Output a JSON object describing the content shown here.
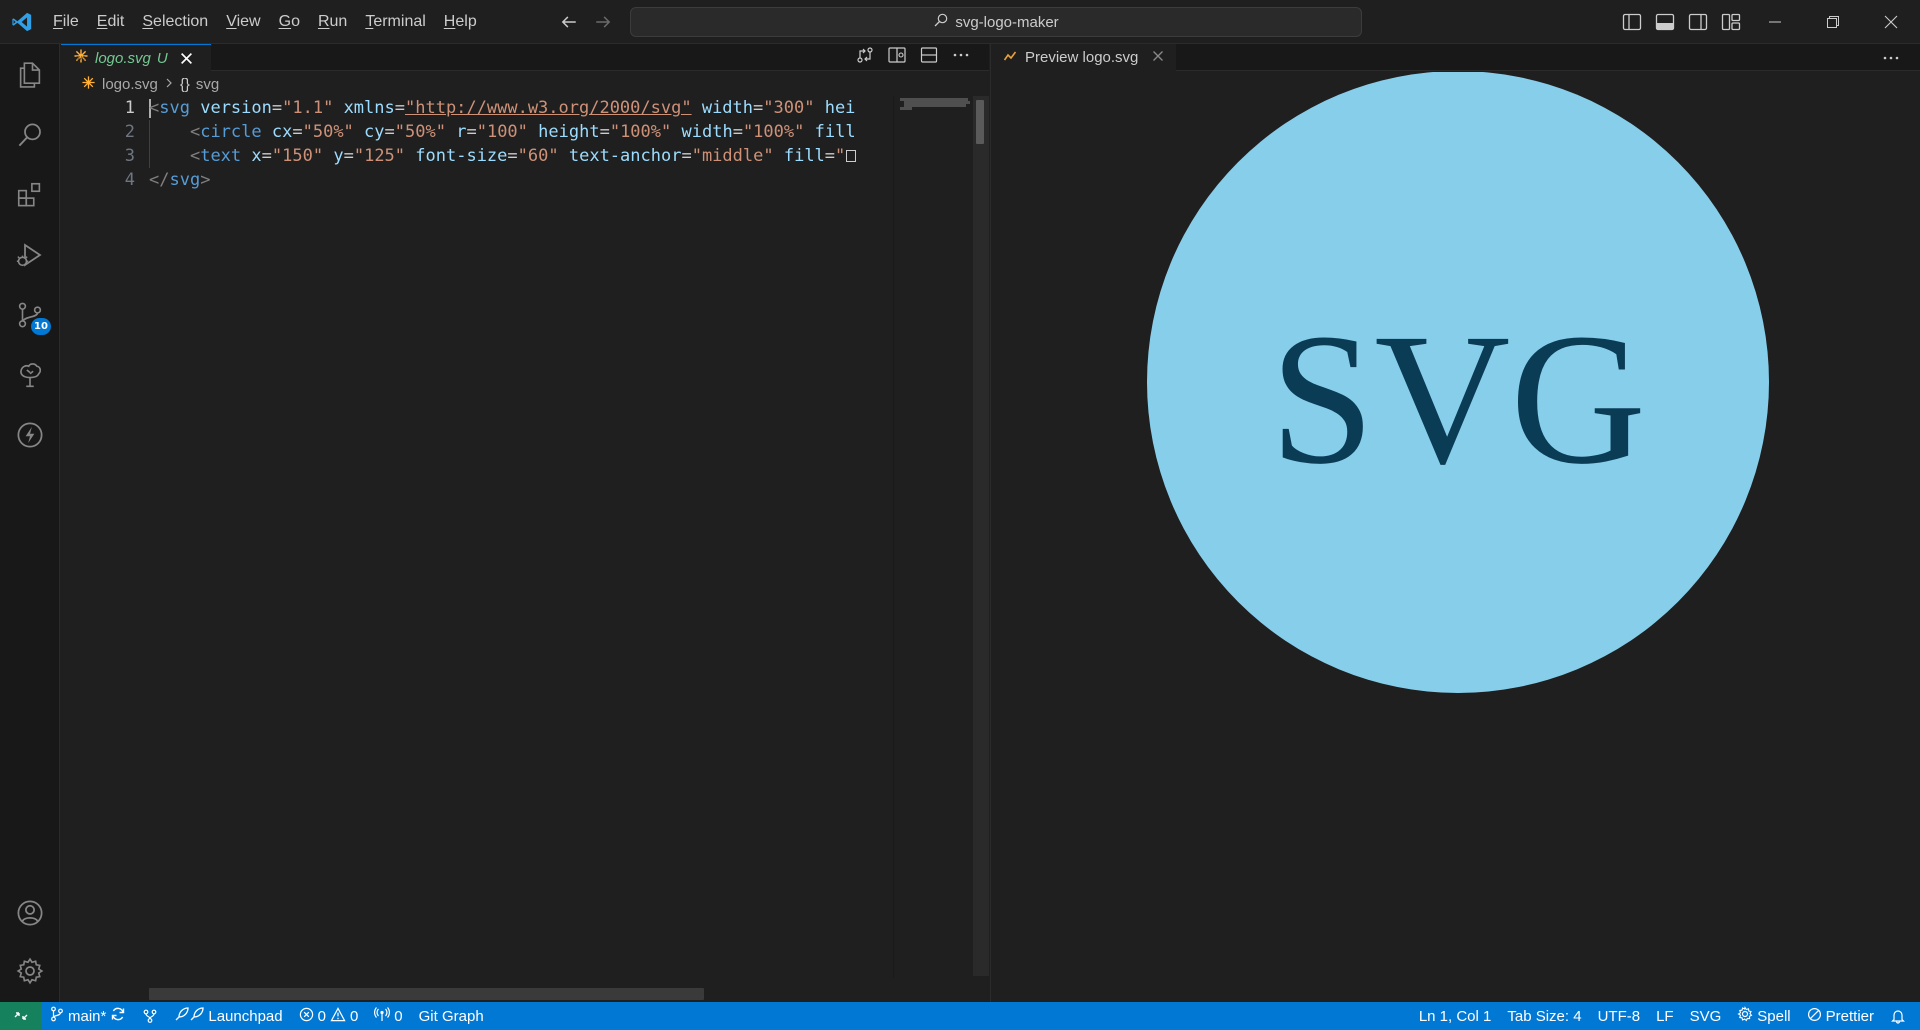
{
  "titlebar": {
    "menu": [
      {
        "label": "File",
        "mnemonic": "F",
        "rest": "ile"
      },
      {
        "label": "Edit",
        "mnemonic": "E",
        "rest": "dit"
      },
      {
        "label": "Selection",
        "mnemonic": "S",
        "rest": "election"
      },
      {
        "label": "View",
        "mnemonic": "V",
        "rest": "iew"
      },
      {
        "label": "Go",
        "mnemonic": "G",
        "rest": "o"
      },
      {
        "label": "Run",
        "mnemonic": "R",
        "rest": "un"
      },
      {
        "label": "Terminal",
        "mnemonic": "T",
        "rest": "erminal"
      },
      {
        "label": "Help",
        "mnemonic": "H",
        "rest": "elp"
      }
    ],
    "search_text": "svg-logo-maker"
  },
  "activitybar": {
    "items": [
      "explorer-icon",
      "search-icon",
      "extensions-icon",
      "run-debug-icon",
      "source-control-icon",
      "git-tree-icon",
      "lightning-icon"
    ],
    "source_control_badge": "10",
    "bottom": [
      "account-icon",
      "gear-icon"
    ]
  },
  "editor": {
    "tab": {
      "label": "logo.svg",
      "status": "U"
    },
    "breadcrumb": {
      "file": "logo.svg",
      "symbol_icon": "{}",
      "symbol": "svg"
    },
    "line_numbers": [
      "1",
      "2",
      "3",
      "4"
    ],
    "lines": {
      "l1": {
        "open": "<",
        "tag": "svg",
        "a1": "version",
        "v1": "\"1.1\"",
        "a2": "xmlns",
        "v2": "\"http://www.w3.org/2000/svg\"",
        "a3": "width",
        "v3": "\"300\"",
        "a4": "hei"
      },
      "l2": {
        "indent": "    ",
        "open": "<",
        "tag": "circle",
        "a1": "cx",
        "v1": "\"50%\"",
        "a2": "cy",
        "v2": "\"50%\"",
        "a3": "r",
        "v3": "\"100\"",
        "a4": "height",
        "v4": "\"100%\"",
        "a5": "width",
        "v5": "\"100%\"",
        "a6": "fill"
      },
      "l3": {
        "indent": "    ",
        "open": "<",
        "tag": "text",
        "a1": "x",
        "v1": "\"150\"",
        "a2": "y",
        "v2": "\"125\"",
        "a3": "font-size",
        "v3": "\"60\"",
        "a4": "text-anchor",
        "v4": "\"middle\"",
        "a5": "fill",
        "v5": "\""
      },
      "l4": {
        "open": "</",
        "tag": "svg",
        "close": ">"
      }
    }
  },
  "preview": {
    "tab_label": "Preview logo.svg",
    "logo_text": "SVG",
    "circle_color": "#87ceeb",
    "text_color": "#0b3c55"
  },
  "statusbar": {
    "branch": "main*",
    "launchpad": "Launchpad",
    "errors": "0",
    "warnings": "0",
    "ports": "0",
    "git_graph": "Git Graph",
    "position": "Ln 1, Col 1",
    "tab_size": "Tab Size: 4",
    "encoding": "UTF-8",
    "eol": "LF",
    "language": "SVG",
    "spell": "Spell",
    "prettier": "Prettier"
  }
}
